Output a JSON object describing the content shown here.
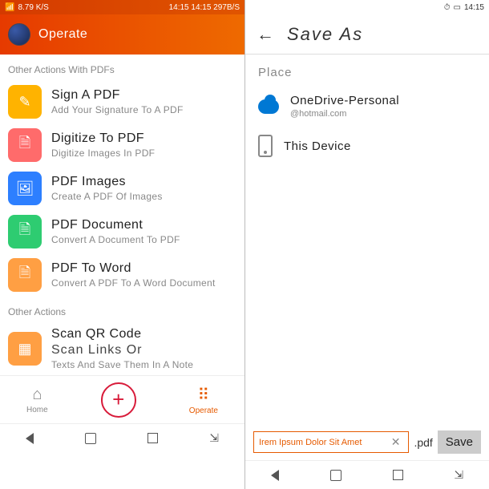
{
  "statusbar_left": {
    "speed": "8.79 K/S",
    "center": "14:15 14:15 297B/S",
    "time": "14:15"
  },
  "statusbar_right": {
    "time": "14:15"
  },
  "left_header": {
    "title": "Operate"
  },
  "sections": {
    "pdf_label": "Other Actions With PDFs",
    "other_label": "Other Actions"
  },
  "items": [
    {
      "title": "Sign A PDF",
      "subtitle": "Add Your Signature To A PDF"
    },
    {
      "title": "Digitize To PDF",
      "subtitle": "Digitize Images In PDF"
    },
    {
      "title": "PDF Images",
      "subtitle": "Create A PDF Of Images"
    },
    {
      "title": "PDF Document",
      "subtitle": "Convert A Document To PDF"
    },
    {
      "title": "PDF To Word",
      "subtitle": "Convert A PDF To A Word Document"
    },
    {
      "title": "Scan QR Code",
      "subtitle": "Texts And Save Them In A Note"
    },
    {
      "subtitle2": "Scan Links Or"
    }
  ],
  "nav": {
    "home": "Home",
    "operate": "Operate",
    "plus": "+"
  },
  "right_header": {
    "title": "Save As"
  },
  "place_label": "Place",
  "places": [
    {
      "name": "OneDrive-Personal",
      "sub": "@hotmail.com"
    },
    {
      "name": "This Device"
    }
  ],
  "save": {
    "filename": "Irem Ipsum Dolor Sit Amet",
    "ext": ".pdf",
    "button": "Save"
  }
}
